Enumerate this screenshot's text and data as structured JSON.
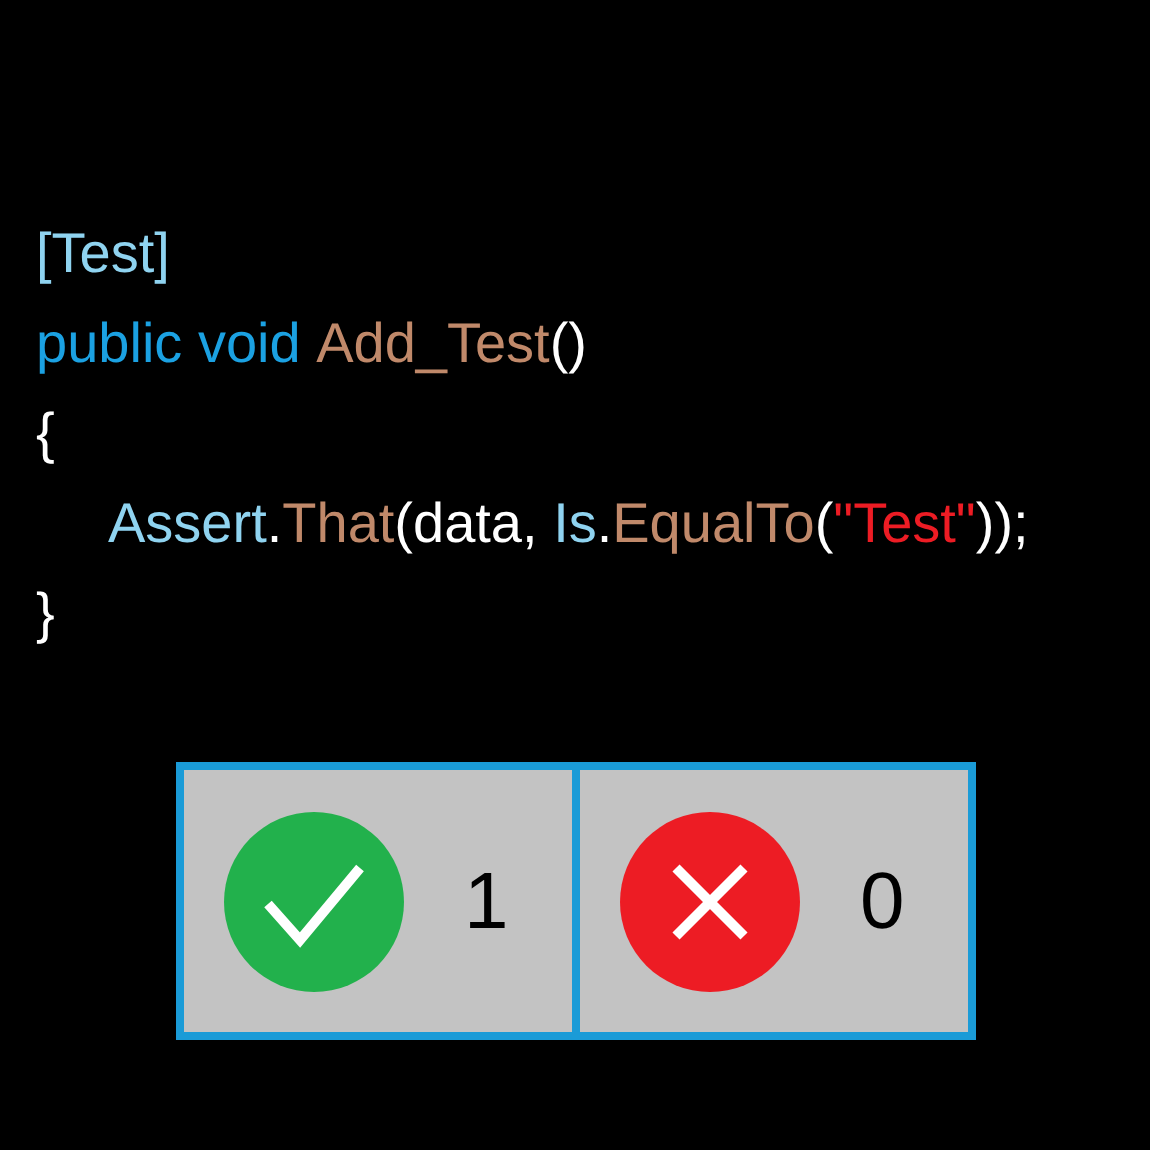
{
  "code_lines": [
    {
      "indented": false,
      "tokens": [
        {
          "kind": "type",
          "text": "[Test]"
        }
      ]
    },
    {
      "indented": false,
      "tokens": [
        {
          "kind": "keyword",
          "text": "public void "
        },
        {
          "kind": "method",
          "text": "Add_Test"
        },
        {
          "kind": "plain",
          "text": "()"
        }
      ]
    },
    {
      "indented": false,
      "tokens": [
        {
          "kind": "plain",
          "text": "{"
        }
      ]
    },
    {
      "indented": true,
      "tokens": [
        {
          "kind": "type",
          "text": "Assert"
        },
        {
          "kind": "plain",
          "text": "."
        },
        {
          "kind": "method",
          "text": "That"
        },
        {
          "kind": "plain",
          "text": "(data, "
        },
        {
          "kind": "type",
          "text": "Is"
        },
        {
          "kind": "plain",
          "text": "."
        },
        {
          "kind": "method",
          "text": "EqualTo"
        },
        {
          "kind": "plain",
          "text": "("
        },
        {
          "kind": "string",
          "text": "\"Test\""
        },
        {
          "kind": "plain",
          "text": "));"
        }
      ]
    },
    {
      "indented": false,
      "tokens": [
        {
          "kind": "plain",
          "text": "}"
        }
      ]
    }
  ],
  "results": [
    {
      "kind": "pass",
      "count": "1"
    },
    {
      "kind": "fail",
      "count": "0"
    }
  ]
}
